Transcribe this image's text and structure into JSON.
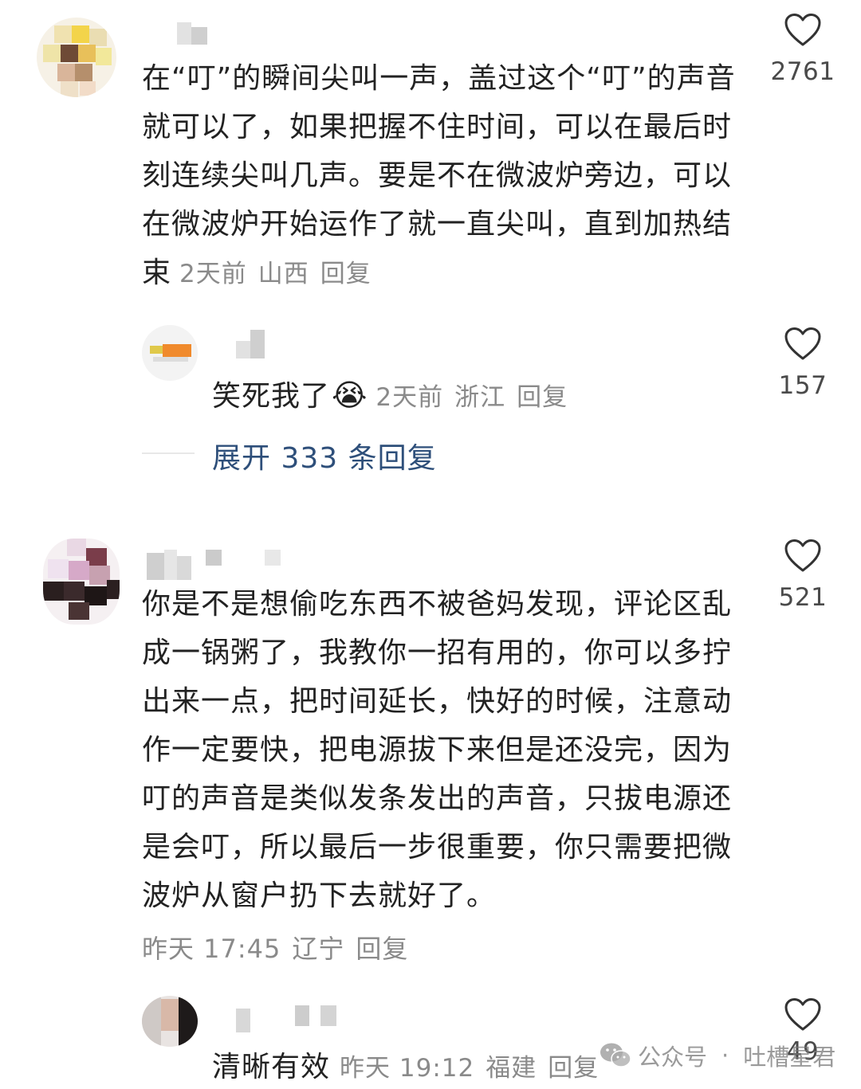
{
  "comments": [
    {
      "text": "在“叮”的瞬间尖叫一声，盖过这个“叮”的声音就可以了，如果把握不住时间，可以在最后时刻连续尖叫几声。要是不在微波炉旁边，可以在微波炉开始运作了就一直尖叫，直到加热结束",
      "time": "2天前",
      "location": "山西",
      "reply_label": "回复",
      "likes": "2761",
      "reply": {
        "text": "笑死我了",
        "emoji": "😭",
        "time": "2天前",
        "location": "浙江",
        "reply_label": "回复",
        "likes": "157"
      },
      "expand": "展开 333 条回复"
    },
    {
      "text": "你是不是想偷吃东西不被爸妈发现，评论区乱成一锅粥了，我教你一招有用的，你可以多拧出来一点，把时间延长，快好的时候，注意动作一定要快，把电源拔下来但是还没完，因为叮的声音是类似发条发出的声音，只拔电源还是会叮，所以最后一步很重要，你只需要把微波炉从窗户扔下去就好了。",
      "time": "昨天 17:45",
      "location": "辽宁",
      "reply_label": "回复",
      "likes": "521",
      "reply": {
        "text": "清晰有效",
        "time": "昨天 19:12",
        "location": "福建",
        "reply_label": "回复",
        "likes": "49"
      }
    }
  ],
  "watermark": {
    "prefix": "公众号",
    "separator": "·",
    "account": "吐槽星君"
  },
  "colors": {
    "link": "#2e4f7a",
    "meta": "#8a8a8a",
    "text": "#222222"
  },
  "icons": [
    "heart-icon",
    "wechat-icon"
  ]
}
